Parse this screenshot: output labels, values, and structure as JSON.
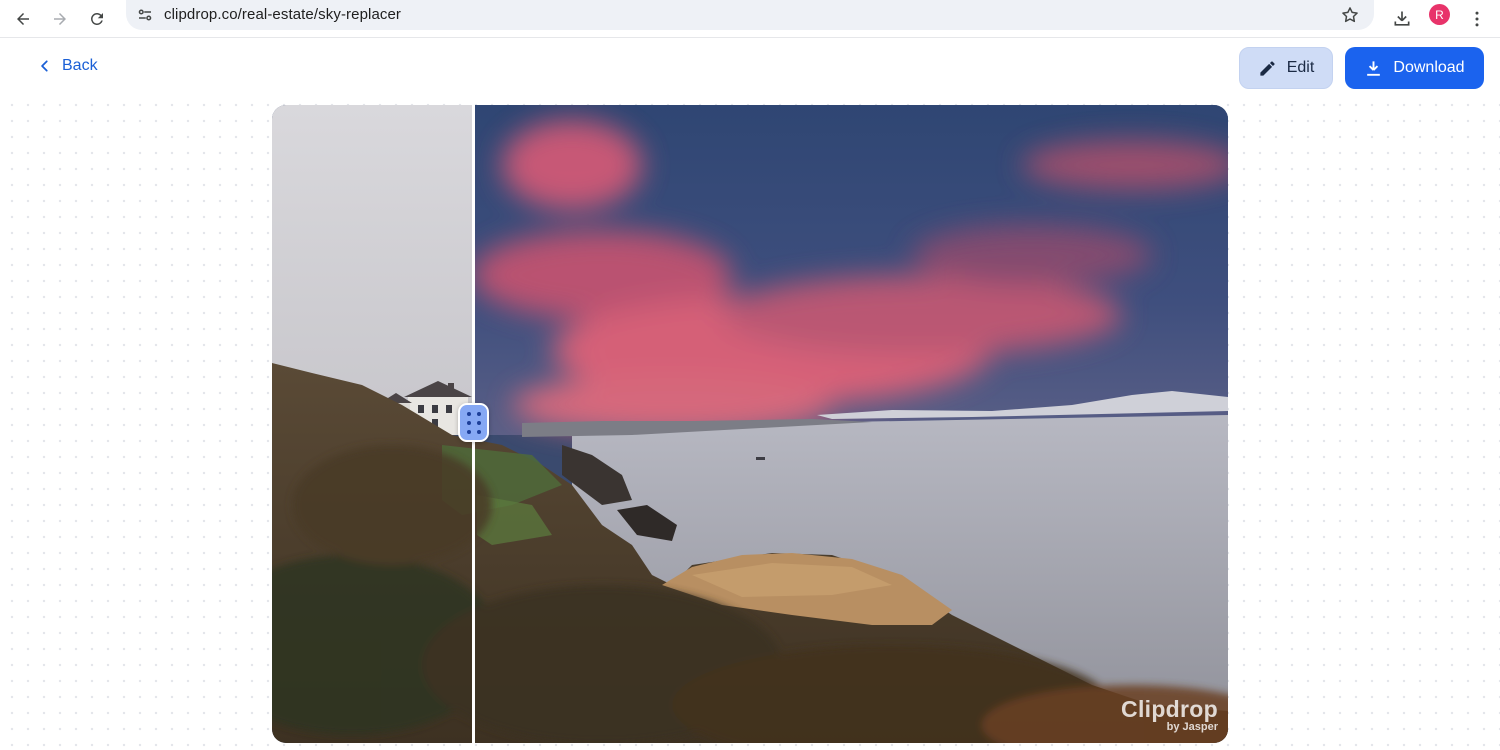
{
  "browser": {
    "url": "clipdrop.co/real-estate/sky-replacer",
    "avatar_initial": "R",
    "avatar_color": "#e8336a",
    "icons": [
      "back-arrow-icon",
      "forward-arrow-icon",
      "reload-icon",
      "site-settings-icon",
      "bookmark-star-icon",
      "downloads-icon",
      "kebab-menu-icon"
    ]
  },
  "toolbar": {
    "back_label": "Back",
    "edit_label": "Edit",
    "download_label": "Download",
    "accent_color": "#1b63ee"
  },
  "compare": {
    "divider_position_percent": 21,
    "watermark_brand": "Clipdrop",
    "watermark_sub": "by Jasper"
  }
}
